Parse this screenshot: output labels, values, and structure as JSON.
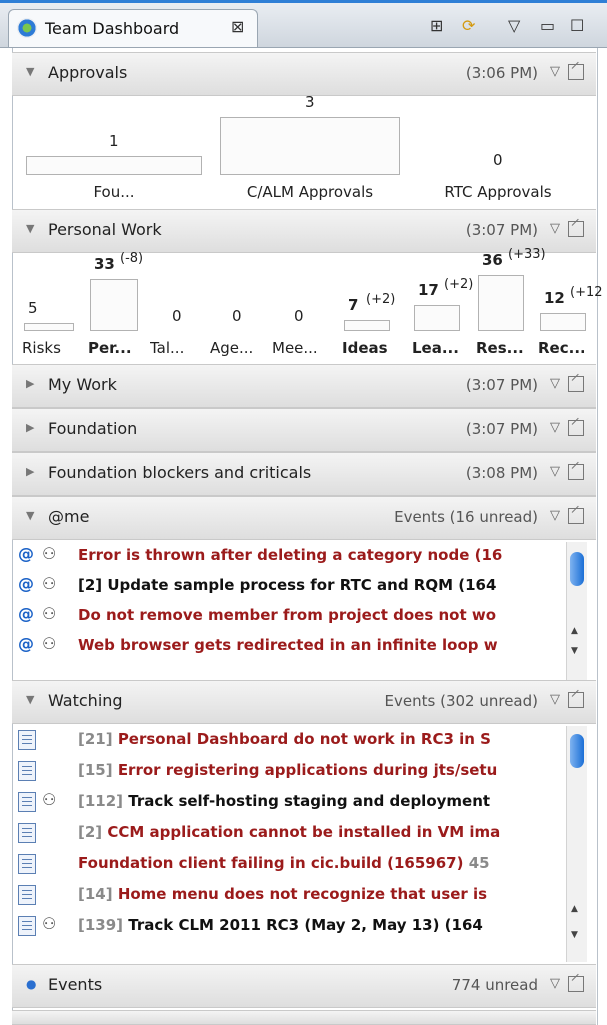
{
  "tab": {
    "title": "Team Dashboard",
    "close": "⊠"
  },
  "toolbar": {
    "add": "⊞",
    "sync": "⟳",
    "menu": "▽",
    "minimize": "▭",
    "maximize": "☐"
  },
  "approvals": {
    "title": "Approvals",
    "time": "(3:06 PM)",
    "bars": [
      {
        "label": "Fou...",
        "value": "1",
        "fraction": 0.33
      },
      {
        "label": "C/ALM Approvals",
        "value": "3",
        "fraction": 1.0
      },
      {
        "label": "RTC Approvals",
        "value": "0",
        "fraction": 0.0
      }
    ]
  },
  "personal_work": {
    "title": "Personal Work",
    "time": "(3:07 PM)",
    "bars": [
      {
        "label": "Risks",
        "value": "5",
        "delta": "",
        "fraction": 0.14,
        "bold_label": false
      },
      {
        "label": "Per...",
        "value": "33",
        "delta": "(-8)",
        "fraction": 0.92,
        "bold_label": true
      },
      {
        "label": "Tal...",
        "value": "0",
        "delta": "",
        "fraction": 0.0,
        "bold_label": false
      },
      {
        "label": "Age...",
        "value": "0",
        "delta": "",
        "fraction": 0.0,
        "bold_label": false
      },
      {
        "label": "Mee...",
        "value": "0",
        "delta": "",
        "fraction": 0.0,
        "bold_label": false
      },
      {
        "label": "Ideas",
        "value": "7",
        "delta": "(+2)",
        "fraction": 0.19,
        "bold_label": true
      },
      {
        "label": "Lea...",
        "value": "17",
        "delta": "(+2)",
        "fraction": 0.47,
        "bold_label": true
      },
      {
        "label": "Res...",
        "value": "36",
        "delta": "(+33)",
        "fraction": 1.0,
        "bold_label": true
      },
      {
        "label": "Rec...",
        "value": "12",
        "delta": "(+12",
        "fraction": 0.33,
        "bold_label": true
      }
    ]
  },
  "collapsed": [
    {
      "title": "My Work",
      "time": "(3:07 PM)"
    },
    {
      "title": "Foundation",
      "time": "(3:07 PM)"
    },
    {
      "title": "Foundation blockers and criticals",
      "time": "(3:08 PM)"
    }
  ],
  "me": {
    "title": "@me",
    "meta": "Events (16 unread)",
    "rows": [
      {
        "text": "Error is thrown after deleting a category node (16",
        "style": "red"
      },
      {
        "text": "[2] Update sample process for RTC and RQM (164",
        "style": "blk"
      },
      {
        "text": "Do not remove member from project does not wo",
        "style": "red"
      },
      {
        "text": "Web browser gets redirected in an infinite loop w",
        "style": "red"
      }
    ]
  },
  "watching": {
    "title": "Watching",
    "meta": "Events (302 unread)",
    "rows": [
      {
        "prefix": "[21]",
        "text": "Personal Dashboard do not work in RC3 in S",
        "style": "red",
        "binoculars": false
      },
      {
        "prefix": "[15]",
        "text": "Error registering applications during jts/setu",
        "style": "red",
        "binoculars": false
      },
      {
        "prefix": "[112]",
        "text": "Track self-hosting staging and deployment",
        "style": "blk",
        "binoculars": true
      },
      {
        "prefix": "[2]",
        "text": "CCM application cannot be installed in VM ima",
        "style": "red",
        "binoculars": false
      },
      {
        "prefix": "",
        "text": "Foundation client failing in cic.build (165967)",
        "suffix": "45",
        "style": "red",
        "binoculars": false
      },
      {
        "prefix": "[14]",
        "text": "Home menu does not recognize that user is",
        "style": "red",
        "binoculars": false
      },
      {
        "prefix": "[139]",
        "text": "Track CLM 2011 RC3 (May 2, May 13) (164",
        "style": "blk",
        "binoculars": true
      }
    ]
  },
  "events": {
    "title": "Events",
    "meta": "774 unread"
  },
  "colors": {
    "unread_red": "#9b1b1b",
    "scroll_thumb": "#1b6fd6"
  }
}
